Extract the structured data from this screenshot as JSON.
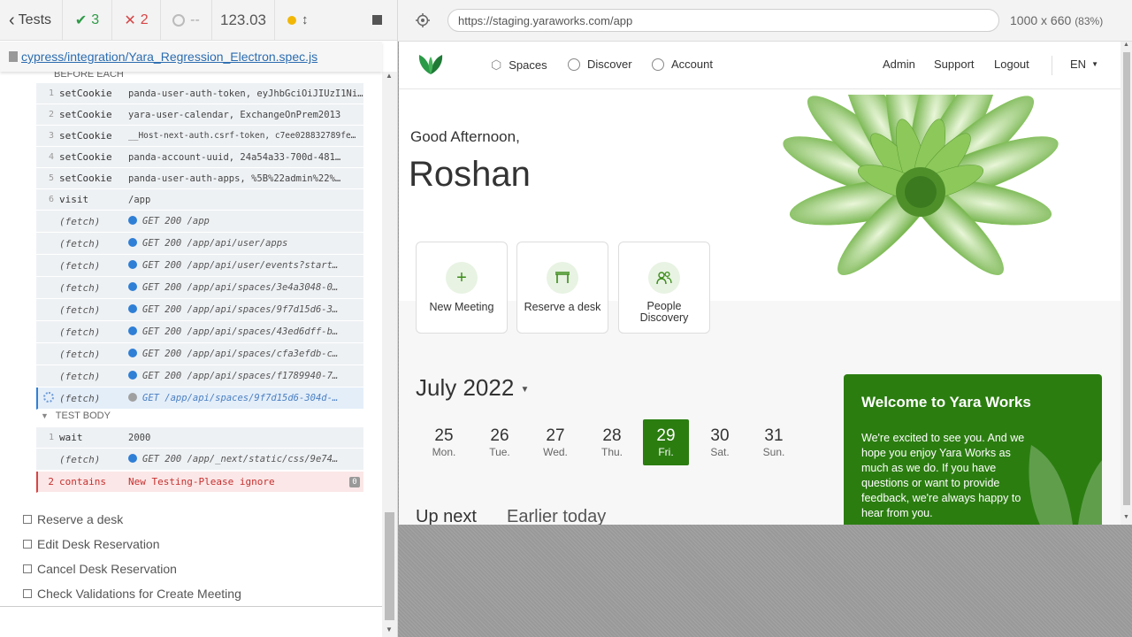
{
  "reporter": {
    "back_label": "Tests",
    "passed": "3",
    "failed": "2",
    "pending": "--",
    "duration": "123.03",
    "spec_path": "cypress/integration/Yara_Regression_Electron.spec.js",
    "before_each_label": "BEFORE EACH",
    "commands": [
      {
        "num": "1",
        "name": "setCookie",
        "arg": "panda-user-auth-token, eyJhbGciOiJIUzI1NiIsI…"
      },
      {
        "num": "2",
        "name": "setCookie",
        "arg": "yara-user-calendar, ExchangeOnPrem2013"
      },
      {
        "num": "3",
        "name": "setCookie",
        "arg": "__Host-next-auth.csrf-token, c7ee028832789fe…"
      },
      {
        "num": "4",
        "name": "setCookie",
        "arg": "panda-account-uuid, 24a54a33-700d-481…"
      },
      {
        "num": "5",
        "name": "setCookie",
        "arg": "panda-user-auth-apps, %5B%22admin%22%…"
      },
      {
        "num": "6",
        "name": "visit",
        "arg": "/app"
      }
    ],
    "fetches": [
      {
        "name": "(fetch)",
        "arg": "GET 200 /app"
      },
      {
        "name": "(fetch)",
        "arg": "GET 200 /app/api/user/apps"
      },
      {
        "name": "(fetch)",
        "arg": "GET 200 /app/api/user/events?start…"
      },
      {
        "name": "(fetch)",
        "arg": "GET 200 /app/api/spaces/3e4a3048-0…"
      },
      {
        "name": "(fetch)",
        "arg": "GET 200 /app/api/spaces/9f7d15d6-3…"
      },
      {
        "name": "(fetch)",
        "arg": "GET 200 /app/api/spaces/43ed6dff-b…"
      },
      {
        "name": "(fetch)",
        "arg": "GET 200 /app/api/spaces/cfa3efdb-c…"
      },
      {
        "name": "(fetch)",
        "arg": "GET 200 /app/api/spaces/f1789940-7…"
      }
    ],
    "pending_fetch": {
      "name": "(fetch)",
      "arg": "GET /app/api/spaces/9f7d15d6-304d-…"
    },
    "test_body_label": "TEST BODY",
    "body_commands": [
      {
        "num": "1",
        "name": "wait",
        "arg": "2000"
      },
      {
        "num": "",
        "name": "(fetch)",
        "arg": "GET 200 /app/_next/static/css/9e74…"
      }
    ],
    "error_command": {
      "num": "2",
      "name": "contains",
      "arg": "New Testing-Please ignore",
      "badge": "0"
    },
    "tests": [
      "Reserve a desk",
      "Edit Desk Reservation",
      "Cancel Desk Reservation",
      "Check Validations for Create Meeting"
    ]
  },
  "browser": {
    "url": "https://staging.yaraworks.com/app",
    "viewport": "1000 x 660",
    "zoom": "(83%)"
  },
  "app": {
    "nav": {
      "spaces": "Spaces",
      "discover": "Discover",
      "account": "Account",
      "admin": "Admin",
      "support": "Support",
      "logout": "Logout",
      "lang": "EN"
    },
    "greeting": "Good Afternoon,",
    "user_name": "Roshan",
    "cards": [
      {
        "label": "New Meeting",
        "icon": "+"
      },
      {
        "label": "Reserve a desk",
        "icon": "desk"
      },
      {
        "label": "People Discovery",
        "icon": "people"
      }
    ],
    "month": "July 2022",
    "days": [
      {
        "d": "25",
        "w": "Mon."
      },
      {
        "d": "26",
        "w": "Tue."
      },
      {
        "d": "27",
        "w": "Wed."
      },
      {
        "d": "28",
        "w": "Thu."
      },
      {
        "d": "29",
        "w": "Fri."
      },
      {
        "d": "30",
        "w": "Sat."
      },
      {
        "d": "31",
        "w": "Sun."
      }
    ],
    "up_next": "Up next",
    "earlier_today": "Earlier today",
    "welcome_title": "Welcome to Yara Works",
    "welcome_text": "We're excited to see you. And we hope you enjoy Yara Works as much as we do. If you have questions or want to provide feedback, we're always happy to hear from you.",
    "brand_color": "#2b7d10"
  }
}
